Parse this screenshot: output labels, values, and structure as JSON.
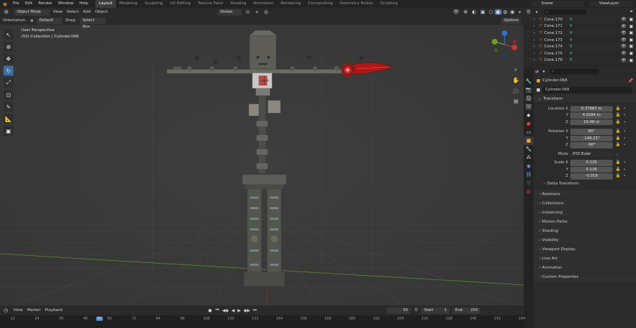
{
  "menu": {
    "items": [
      "File",
      "Edit",
      "Render",
      "Window",
      "Help"
    ]
  },
  "workspaces": {
    "tabs": [
      "Layout",
      "Modeling",
      "Sculpting",
      "UV Editing",
      "Texture Paint",
      "Shading",
      "Animation",
      "Rendering",
      "Compositing",
      "Geometry Nodes",
      "Scripting"
    ],
    "active": "Layout"
  },
  "scene": {
    "name": "Scene",
    "view_layer": "ViewLayer"
  },
  "viewport_header": {
    "mode": "Object Mode",
    "menus": [
      "View",
      "Select",
      "Add",
      "Object"
    ],
    "transform": "Global",
    "options": "Options"
  },
  "tool_header": {
    "orientation_label": "Orientation:",
    "orientation_value": "Default",
    "drag_label": "Drag:",
    "drag_value": "Select Box"
  },
  "viewport": {
    "view_name": "User Perspective",
    "context": "(55) Collection | Cylinder.068"
  },
  "outliner": {
    "search_placeholder": "",
    "rows": [
      "Cone.170",
      "Cone.171",
      "Cone.172",
      "Cone.173",
      "Cone.174",
      "Cone.175",
      "Cone.176"
    ]
  },
  "properties": {
    "object_name": "Cylinder.068",
    "datablock_name": "Cylinder.068",
    "transform_header": "Transform",
    "location": {
      "label_x": "Location X",
      "x": "0.37987 m",
      "y": "4.0284 m",
      "z": "10.48 m"
    },
    "rotation": {
      "label_x": "Rotation X",
      "x": "90°",
      "y": "-146.21°",
      "z": "-90°"
    },
    "mode": {
      "label": "Mode",
      "value": "XYZ Euler"
    },
    "scale": {
      "label_x": "Scale X",
      "x": "0.125",
      "y": "0.126",
      "z": "-0.019"
    },
    "axis_y": "Y",
    "axis_z": "Z",
    "delta": "Delta Transform",
    "sections": [
      "Relations",
      "Collections",
      "Instancing",
      "Motion Paths",
      "Shading",
      "Visibility",
      "Viewport Display",
      "Line Art",
      "Animation",
      "Custom Properties"
    ]
  },
  "timeline": {
    "menus": [
      "View",
      "Marker",
      "Playback"
    ],
    "current_frame": "55",
    "start_label": "Start",
    "start": "1",
    "end_label": "End",
    "end": "250",
    "ruler": [
      "12",
      "24",
      "36",
      "48",
      "55",
      "60",
      "72",
      "84",
      "96",
      "108",
      "120",
      "132",
      "144",
      "156",
      "168",
      "180",
      "192",
      "204",
      "216",
      "228",
      "240",
      "252",
      "264"
    ]
  },
  "colors": {
    "accent": "#3f6c9f",
    "playhead": "#4a7fd0",
    "xaxis": "#8a2e2e",
    "yaxis": "#5f8a2a",
    "selected": "#ff8c1a"
  }
}
